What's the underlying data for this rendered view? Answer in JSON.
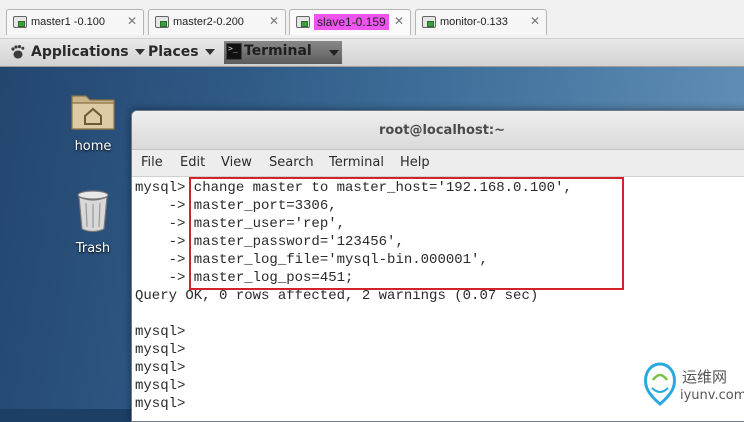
{
  "vm_tabs": [
    {
      "label": "master1 -0.100",
      "active": false
    },
    {
      "label": "master2-0.200",
      "active": false
    },
    {
      "label": "slave1-0.159",
      "active": true
    },
    {
      "label": "monitor-0.133",
      "active": false
    }
  ],
  "tab_close_glyph": "✕",
  "panel": {
    "applications": "Applications",
    "places": "Places",
    "terminal_launcher": "Terminal"
  },
  "desktop_icons": [
    {
      "label": "home",
      "icon": "home-folder-icon"
    },
    {
      "label": "Trash",
      "icon": "trash-icon"
    }
  ],
  "terminal_window": {
    "title": "root@localhost:~",
    "menu": [
      "File",
      "Edit",
      "View",
      "Search",
      "Terminal",
      "Help"
    ],
    "lines": [
      "mysql> change master to master_host='192.168.0.100',",
      "    -> master_port=3306,",
      "    -> master_user='rep',",
      "    -> master_password='123456',",
      "    -> master_log_file='mysql-bin.000001',",
      "    -> master_log_pos=451;",
      "Query OK, 0 rows affected, 2 warnings (0.07 sec)",
      "",
      "mysql>",
      "mysql>",
      "mysql>",
      "mysql>",
      "mysql>"
    ]
  },
  "highlight_color": "#d0232a",
  "watermark": {
    "cn": "运维网",
    "en": "iyunv.com"
  }
}
